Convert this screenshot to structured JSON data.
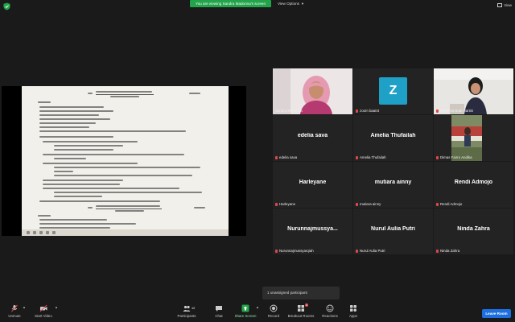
{
  "topbar": {
    "banner": "You are viewing Sandra Madonna's screen",
    "view_options": "View Options",
    "view": "View"
  },
  "participants_tiles": [
    {
      "name": "Sandra Madonna",
      "label": ""
    },
    {
      "name": "zoom baa04",
      "label": "Z"
    },
    {
      "name": "Rokhima Budi Hartini",
      "label": ""
    },
    {
      "name": "edelia sava",
      "label": "edelia sava"
    },
    {
      "name": "Amelia Thufailah",
      "label": "Amelia Thufailah"
    },
    {
      "name": "Dimas Fairro Andika",
      "label": ""
    },
    {
      "name": "Harleyane",
      "label": "Harleyane"
    },
    {
      "name": "mutiara ainny",
      "label": "mutiara ainny"
    },
    {
      "name": "Rendi Admojo",
      "label": "Rendi Admojo"
    },
    {
      "name": "Nurunnajmussyarqiah",
      "label": "Nurunnajmussya..."
    },
    {
      "name": "Nurul Aulia Putri",
      "label": "Nurul Aulia Putri"
    },
    {
      "name": "Ninda Zahra",
      "label": "Ninda Zahra"
    }
  ],
  "unassigned": "1 unassigned participant",
  "controls": {
    "unmute": "Unmute",
    "start_video": "Start Video",
    "participants": "Participants",
    "participants_count": "12",
    "chat": "Chat",
    "share_screen": "Share Screen",
    "record": "Record",
    "breakout": "Breakout Rooms",
    "breakout_count": "1",
    "reactions": "Reactions",
    "apps": "Apps",
    "leave": "Leave Room"
  },
  "colors": {
    "banner": "#23a34a",
    "leave": "#1d6fe0",
    "active_speaker": "#e6e24c",
    "muted_mic": "#e04747",
    "zoom_avatar": "#1fa1c7"
  }
}
